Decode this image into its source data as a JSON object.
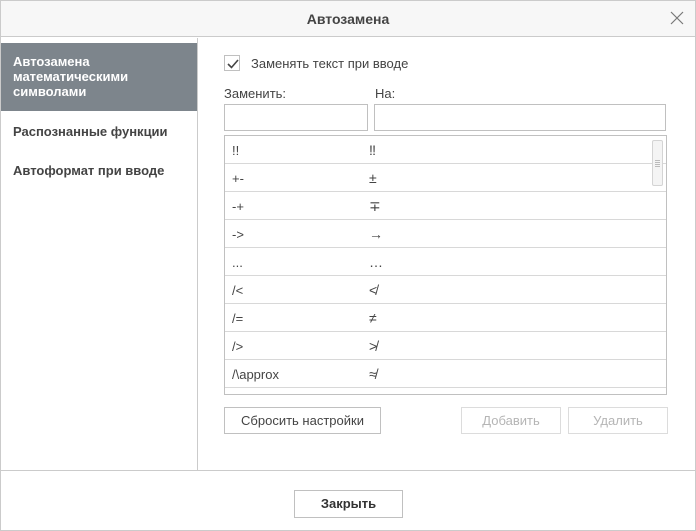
{
  "dialog": {
    "title": "Автозамена",
    "close_label": "Закрыть"
  },
  "sidebar": {
    "items": [
      {
        "label": "Автозамена математическими символами",
        "active": true
      },
      {
        "label": "Распознанные функции",
        "active": false
      },
      {
        "label": "Автоформат при вводе",
        "active": false
      }
    ]
  },
  "options": {
    "replace_on_type_label": "Заменять текст при вводе",
    "replace_on_type_checked": true
  },
  "fields": {
    "replace_label": "Заменить:",
    "with_label": "На:",
    "replace_value": "",
    "with_value": ""
  },
  "table": {
    "rows": [
      {
        "from": "!!",
        "to": "‼"
      },
      {
        "from": "+-",
        "to": "±"
      },
      {
        "from": "-+",
        "to": "∓"
      },
      {
        "from": "->",
        "to": "→"
      },
      {
        "from": "...",
        "to": "…"
      },
      {
        "from": "/<",
        "to": "≮"
      },
      {
        "from": "/=",
        "to": "≠"
      },
      {
        "from": "/>",
        "to": "≯"
      },
      {
        "from": "/\\approx",
        "to": "≉"
      }
    ]
  },
  "buttons": {
    "reset": "Сбросить настройки",
    "add": "Добавить",
    "delete": "Удалить"
  }
}
